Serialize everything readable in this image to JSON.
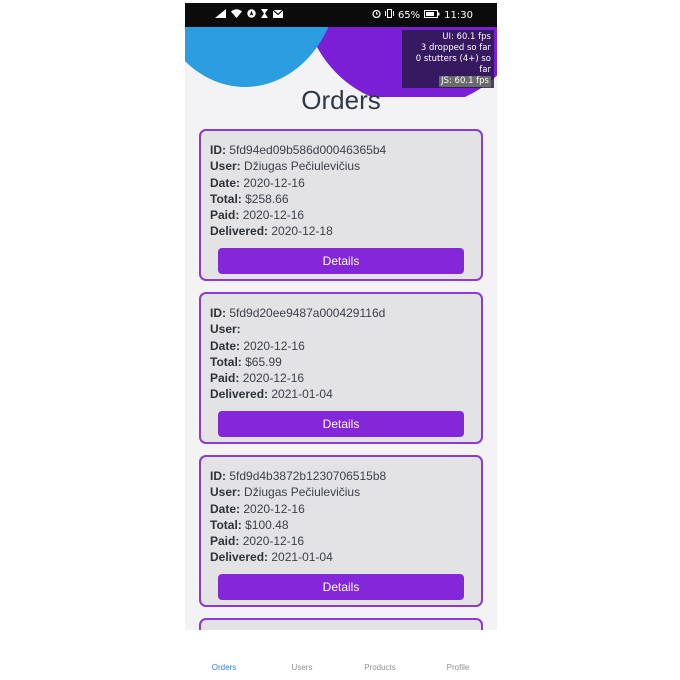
{
  "status_bar": {
    "left_icons": [
      "signal-icon",
      "wifi-icon",
      "location-icon",
      "hourglass-icon",
      "mail-icon"
    ],
    "battery_percent": "65%",
    "time": "11:30"
  },
  "perf_monitor": {
    "ui_fps": "UI: 60.1 fps",
    "dropped": "3 dropped so far",
    "stutters": "0 stutters (4+) so far",
    "js_fps": "JS: 60.1 fps"
  },
  "page": {
    "title": "Orders"
  },
  "labels": {
    "id": "ID:",
    "user": "User:",
    "date": "Date:",
    "total": "Total:",
    "paid": "Paid:",
    "delivered": "Delivered:",
    "details_button": "Details"
  },
  "orders": [
    {
      "id": "5fd94ed09b586d00046365b4",
      "user": "Džiugas Pečiulevičius",
      "date": "2020-12-16",
      "total": "$258.66",
      "paid": "2020-12-16",
      "delivered": "2020-12-18"
    },
    {
      "id": "5fd9d20ee9487a000429116d",
      "user": "",
      "date": "2020-12-16",
      "total": "$65.99",
      "paid": "2020-12-16",
      "delivered": "2021-01-04"
    },
    {
      "id": "5fd9d4b3872b1230706515b8",
      "user": "Džiugas Pečiulevičius",
      "date": "2020-12-16",
      "total": "$100.48",
      "paid": "2020-12-16",
      "delivered": "2021-01-04"
    }
  ],
  "tabs": [
    {
      "label": "Orders",
      "active": true
    },
    {
      "label": "Users",
      "active": false
    },
    {
      "label": "Products",
      "active": false
    },
    {
      "label": "Profile",
      "active": false
    }
  ],
  "colors": {
    "accent_purple": "#8327d8",
    "card_border": "#8a3ad6",
    "blob_blue": "#2a9ee0",
    "blob_purple": "#7a1fd6",
    "active_tab": "#2b7fe0"
  }
}
